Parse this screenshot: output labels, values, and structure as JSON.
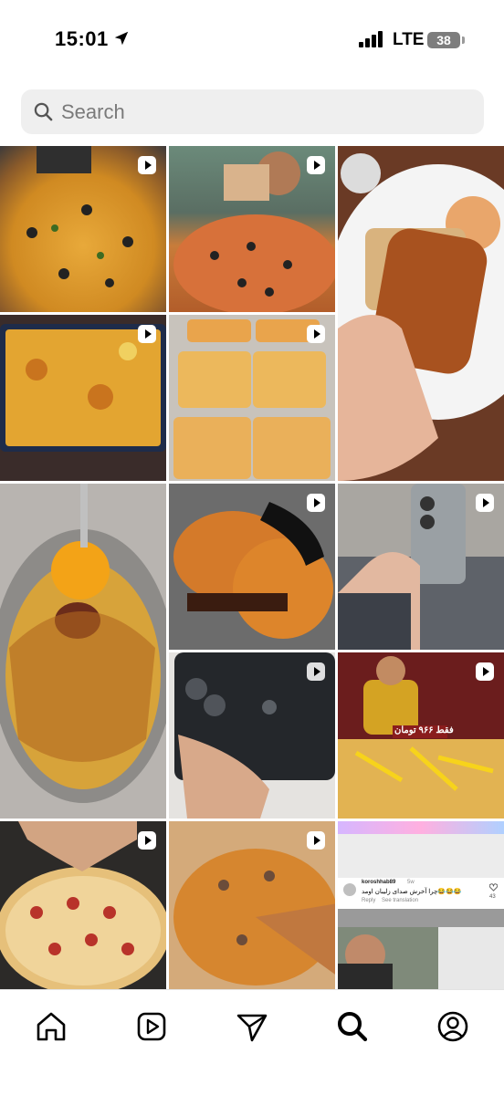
{
  "status": {
    "time": "15:01",
    "network": "LTE",
    "battery": "38"
  },
  "search": {
    "placeholder": "Search"
  },
  "tiles": [
    {
      "icon": "reel-icon"
    },
    {
      "icon": "reel-icon"
    },
    {
      "icon": "none"
    },
    {
      "icon": "reel-icon"
    },
    {
      "icon": "reel-icon"
    },
    {
      "icon": "none"
    },
    {
      "icon": "reel-icon"
    },
    {
      "icon": "reel-icon"
    },
    {
      "icon": "reel-icon"
    },
    {
      "icon": "reel-icon"
    },
    {
      "icon": "reel-icon"
    },
    {
      "icon": "reel-icon"
    }
  ],
  "comment_tile": {
    "username": "koroshhab89",
    "age": "5w",
    "text": "چرا آخرش صدای زلیبان اومد😂😂😂",
    "reply": "Reply",
    "see_translation": "See translation",
    "likes": "43"
  },
  "price_banner": "فقط ۹۶۶ تومان",
  "nav": [
    "home-icon",
    "reels-icon",
    "direct-icon",
    "search-icon",
    "profile-icon"
  ]
}
